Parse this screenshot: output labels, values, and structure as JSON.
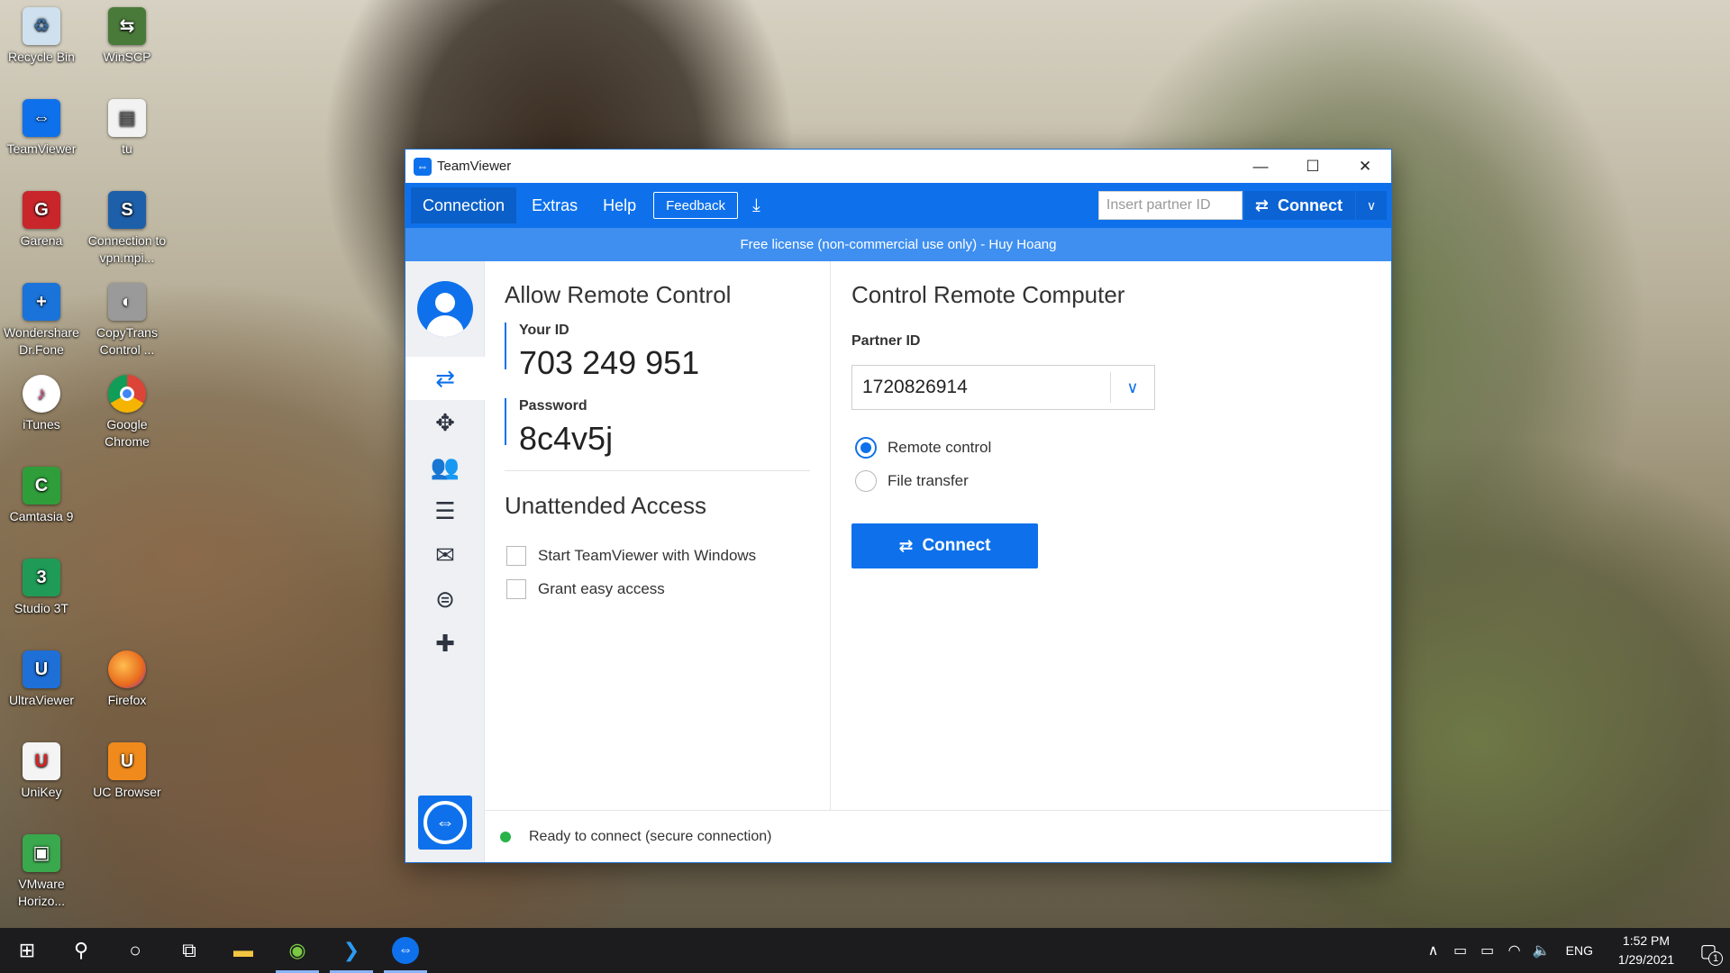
{
  "desktop": {
    "icons": [
      {
        "label": "Recycle Bin",
        "glyph": "♻",
        "color": "#7aa3c8"
      },
      {
        "label": "WinSCP",
        "glyph": "⇆",
        "color": "#4a7a3a"
      },
      {
        "label": "TeamViewer",
        "glyph": "⇔",
        "color": "#0e71eb"
      },
      {
        "label": "tu",
        "glyph": "▤",
        "color": "#e9e9e9"
      },
      {
        "label": "Garena",
        "glyph": "G",
        "color": "#c8262b"
      },
      {
        "label": "Connection to vpn.mpi...",
        "glyph": "S",
        "color": "#1d5fa8"
      },
      {
        "label": "Wondershare Dr.Fone",
        "glyph": "+",
        "color": "#1a73d9"
      },
      {
        "label": "CopyTrans Control ...",
        "glyph": "◐",
        "color": "#9a9a9a"
      },
      {
        "label": "iTunes",
        "glyph": "♪",
        "color": "#e04a8a"
      },
      {
        "label": "Google Chrome",
        "glyph": "●",
        "color": "#2f8d3f"
      },
      {
        "label": "Camtasia 9",
        "glyph": "C",
        "color": "#2f9e3a"
      },
      {
        "label": "Studio 3T",
        "glyph": "3",
        "color": "#1f9a57"
      },
      {
        "label": "UltraViewer",
        "glyph": "U",
        "color": "#1e6fd6"
      },
      {
        "label": "Firefox",
        "glyph": "🦊",
        "color": "#e86a1c"
      },
      {
        "label": "UniKey",
        "glyph": "U",
        "color": "#d22"
      },
      {
        "label": "UC Browser",
        "glyph": "U",
        "color": "#f08a1c"
      },
      {
        "label": "VMware Horizo...",
        "glyph": "▣",
        "color": "#3aa84c"
      }
    ]
  },
  "window": {
    "title": "TeamViewer",
    "controls": {
      "minimize": "—",
      "maximize": "☐",
      "close": "✕"
    }
  },
  "menubar": {
    "items": [
      "Connection",
      "Extras",
      "Help"
    ],
    "feedback": "Feedback",
    "partner_placeholder": "Insert partner ID",
    "connect": "Connect"
  },
  "banner": "Free license (non-commercial use only) - Huy Hoang",
  "allow_remote": {
    "title": "Allow Remote Control",
    "your_id_label": "Your ID",
    "your_id": "703 249 951",
    "password_label": "Password",
    "password": "8c4v5j"
  },
  "unattended": {
    "title": "Unattended Access",
    "start_with_windows": "Start TeamViewer with Windows",
    "grant_easy_access": "Grant easy access"
  },
  "control_remote": {
    "title": "Control Remote Computer",
    "partner_id_label": "Partner ID",
    "partner_id": "1720826914",
    "remote_control": "Remote control",
    "file_transfer": "File transfer",
    "connect": "Connect"
  },
  "status": "Ready to connect (secure connection)",
  "taskbar": {
    "lang": "ENG",
    "time": "1:52 PM",
    "date": "1/29/2021",
    "notifications": "1"
  },
  "colors": {
    "accent": "#0e71eb",
    "banner": "#3f8ff0",
    "status_ok": "#28b34a"
  }
}
